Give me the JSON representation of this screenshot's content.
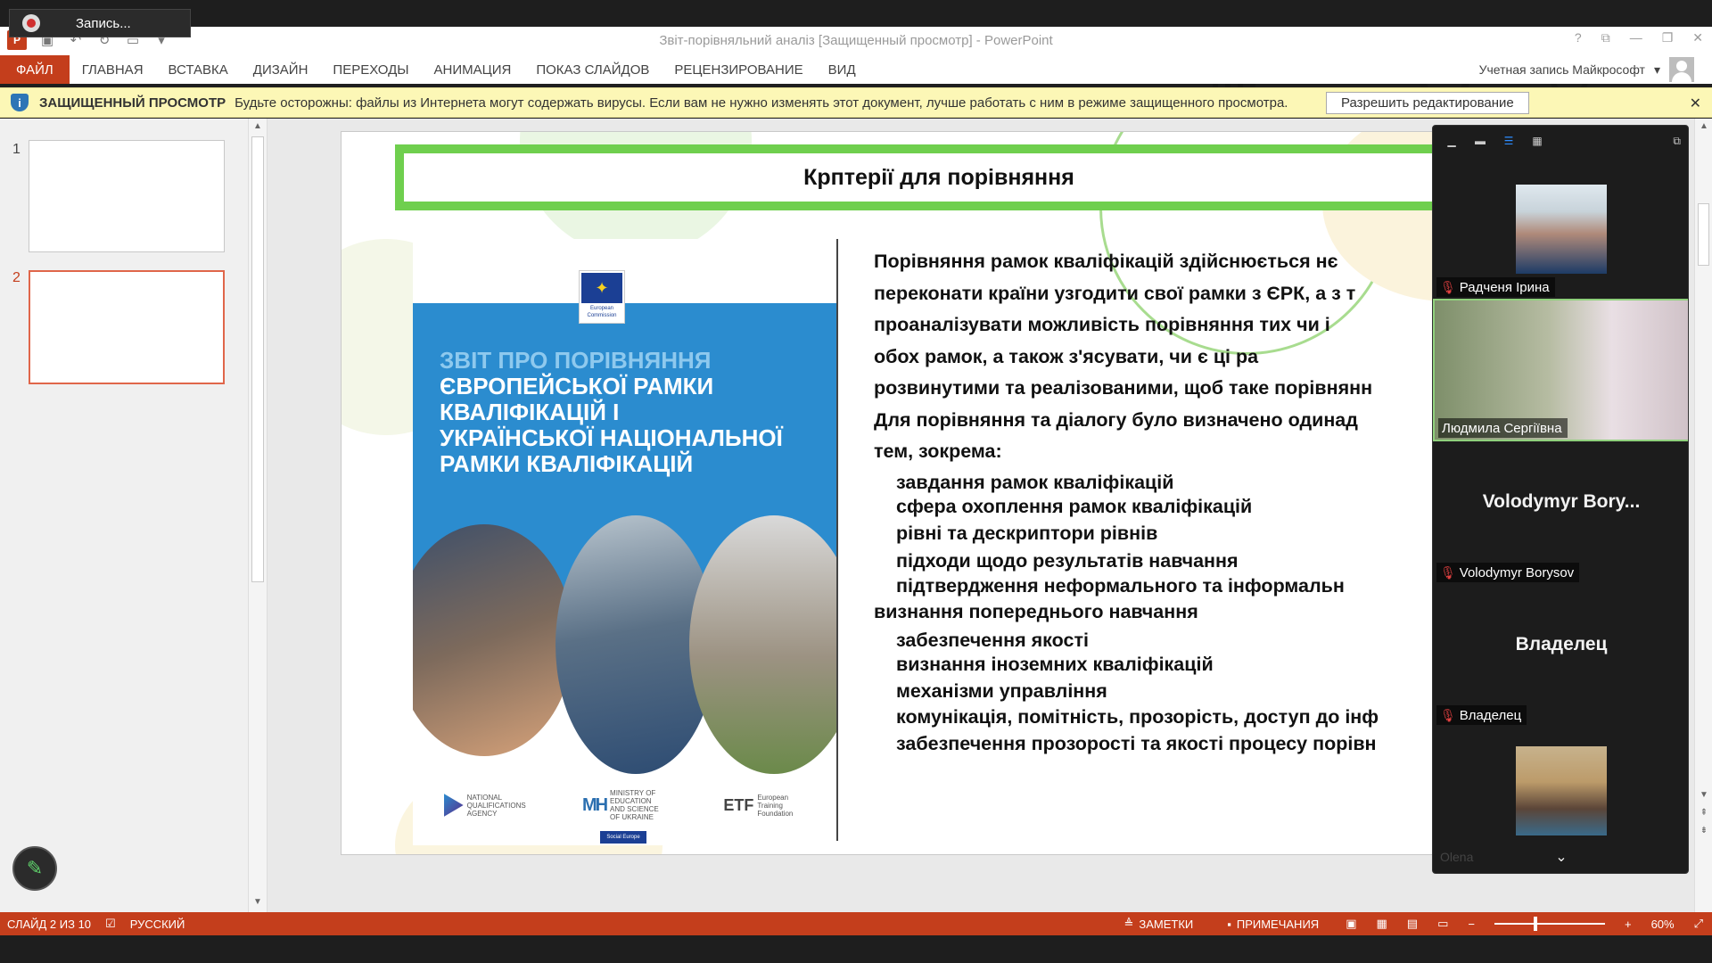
{
  "recording": {
    "label": "Запись..."
  },
  "window": {
    "title": "Звіт-порівняльний аналіз [Защищенный просмотр] - PowerPoint",
    "controls": [
      "?",
      "⧉",
      "—",
      "❐",
      "✕"
    ]
  },
  "ribbon": {
    "file_tab": "ФАЙЛ",
    "tabs": [
      "ГЛАВНАЯ",
      "ВСТАВКА",
      "ДИЗАЙН",
      "ПЕРЕХОДЫ",
      "АНИМАЦИЯ",
      "ПОКАЗ СЛАЙДОВ",
      "РЕЦЕНЗИРОВАНИЕ",
      "ВИД"
    ],
    "account": "Учетная запись Майкрософт"
  },
  "protected_view": {
    "title": "ЗАЩИЩЕННЫЙ ПРОСМОТР",
    "message": "Будьте осторожны: файлы из Интернета могут содержать вирусы. Если вам не нужно изменять этот документ, лучше работать с ним в режиме защищенного просмотра.",
    "enable_button": "Разрешить редактирование"
  },
  "thumbnails": [
    {
      "number": "1",
      "selected": false
    },
    {
      "number": "2",
      "selected": true
    }
  ],
  "slide": {
    "title": "Крптерії для порівняння",
    "cover": {
      "eu_label": "European Commission",
      "title_faded": "Звіт про порівняння",
      "title_lines": [
        "Європейської рамки",
        "кваліфікацій і",
        "української національної",
        "рамки кваліфікацій"
      ],
      "logo_nqa": "NATIONAL QUALIFICATIONS AGENCY",
      "logo_mh": "МН",
      "logo_mh_caption": "MINISTRY OF EDUCATION AND SCIENCE OF UKRAINE",
      "logo_etf": "ETF",
      "logo_etf_caption": "European Training Foundation",
      "social_badge": "Social Europe"
    },
    "paragraphs": [
      "   Порівняння рамок кваліфікацій здійснюється нє",
      "переконати країни узгодити свої рамки з ЄРК, а з т",
      "проаналізувати можливість порівняння тих чи  і",
      "обох  рамок,  а  також  з'ясувати,  чи  є  ці  ра",
      "розвинутими та реалізованими, щоб таке порівнянн",
      "Для порівняння та діалогу було визначено одинад",
      "тем, зокрема:"
    ],
    "items_1": [
      "завдання рамок кваліфікацій",
      "сфера охоплення рамок кваліфікацій",
      "рівні та дескриптори рівнів",
      "підходи щодо результатів навчання",
      " підтвердження  неформального  та  інформальн"
    ],
    "items_1_cont": "визнання попереднього навчання",
    "items_2": [
      "забезпечення якості",
      "визнання іноземних кваліфікацій",
      "механізми управління",
      "комунікація, помітність, прозорість, доступ до інф",
      "забезпечення прозорості та якості процесу порівн"
    ]
  },
  "participants": [
    {
      "name": "Радченя Ірина",
      "type": "photo",
      "muted": true
    },
    {
      "name": "Людмила Сергіївна",
      "type": "video",
      "muted": false,
      "active": true
    },
    {
      "name": "Volodymyr Borysov",
      "display": "Volodymyr Bory...",
      "type": "name",
      "muted": true
    },
    {
      "name": "Владелец",
      "display": "Владелец",
      "type": "name",
      "muted": true
    },
    {
      "name": "Olena",
      "type": "photo",
      "muted": false
    }
  ],
  "status_bar": {
    "slide_info": "СЛАЙД 2 ИЗ 10",
    "language": "РУССКИЙ",
    "notes": "ЗАМЕТКИ",
    "comments": "ПРИМЕЧАНИЯ",
    "zoom": "60%"
  }
}
